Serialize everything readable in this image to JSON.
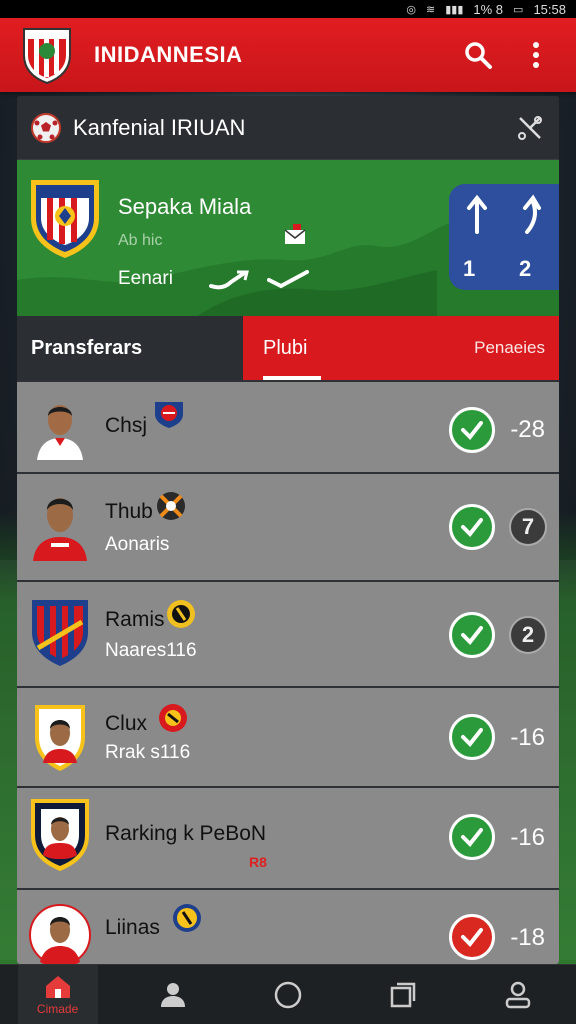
{
  "status_bar": {
    "time": "15:58",
    "battery": "1% 8"
  },
  "app_bar": {
    "title": "INIDANNESIA"
  },
  "panel": {
    "title": "Kanfenial IRIUAN",
    "banner": {
      "team": "Sepaka Miala",
      "sub": "Ab hic",
      "label": "Eenari",
      "score_home": "1",
      "score_away": "2"
    },
    "tabs": [
      {
        "label": "Pransferars"
      },
      {
        "label": "Plubi"
      },
      {
        "label": "Penaeies"
      }
    ],
    "rows": [
      {
        "name": "Chsj",
        "sub": "",
        "value": "-28",
        "kind": "value",
        "check": "green"
      },
      {
        "name": "Thub",
        "sub": "Aonaris",
        "value": "7",
        "kind": "circle",
        "check": "green"
      },
      {
        "name": "Ramis",
        "sub": "Naares116",
        "value": "2",
        "kind": "circle",
        "check": "green"
      },
      {
        "name": "Clux",
        "sub": "Rrak s116",
        "value": "-16",
        "kind": "value",
        "check": "green"
      },
      {
        "name": "Rarking k PeBoN",
        "sub": "",
        "tag": "R8",
        "value": "-16",
        "kind": "value",
        "check": "green"
      },
      {
        "name": "Liinas",
        "sub": "",
        "value": "-18",
        "kind": "value",
        "check": "red"
      }
    ]
  },
  "bottom_nav": {
    "home_label": "Cimade"
  },
  "colors": {
    "primary_red": "#e11d21",
    "pitch_green": "#2f8a35",
    "score_blue": "#2d4f9e",
    "check_green": "#2a9a3a"
  }
}
